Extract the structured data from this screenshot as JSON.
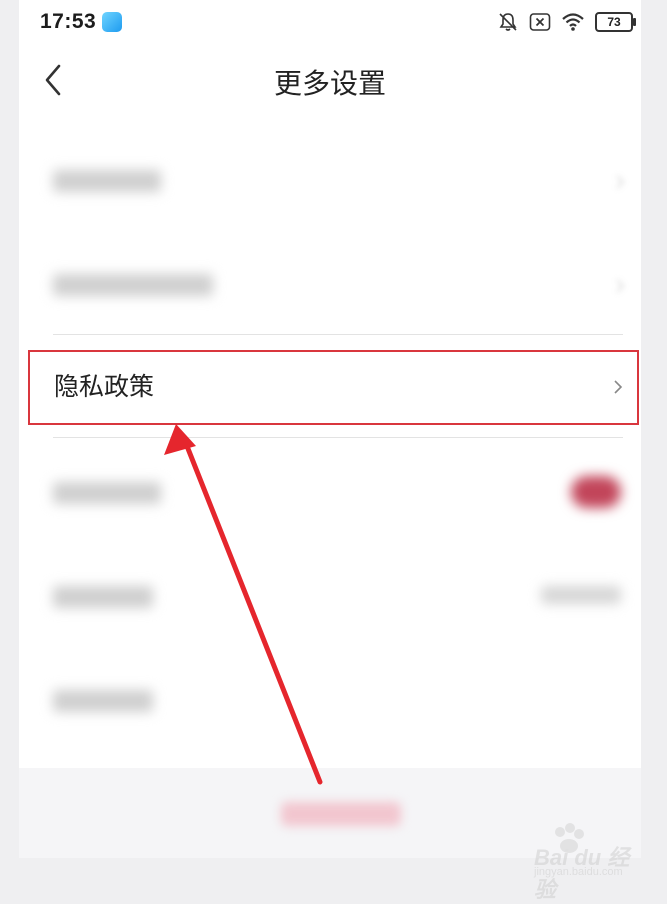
{
  "status_bar": {
    "time": "17:53",
    "icons": [
      "app-icon",
      "bell-off-icon",
      "sim-off-icon",
      "wifi-icon",
      "battery-icon"
    ],
    "battery_level": "73"
  },
  "nav": {
    "back_icon": "chevron-left-icon",
    "title": "更多设置"
  },
  "rows": [
    {
      "label": "",
      "blurred": true
    },
    {
      "label": "",
      "blurred": true
    },
    {
      "label": "隐私政策",
      "highlighted": true,
      "chevron": "chevron-right-icon"
    },
    {
      "label": "",
      "blurred": true,
      "control": "toggle"
    },
    {
      "label": "",
      "blurred": true
    },
    {
      "label": "",
      "blurred": true
    }
  ],
  "logout": {
    "label": ""
  },
  "annotation": {
    "color": "#e5262d",
    "highlight_color": "#d9363e"
  },
  "watermark": {
    "brand": "Bai du 经验",
    "sub": "jingyan.baidu.com"
  }
}
